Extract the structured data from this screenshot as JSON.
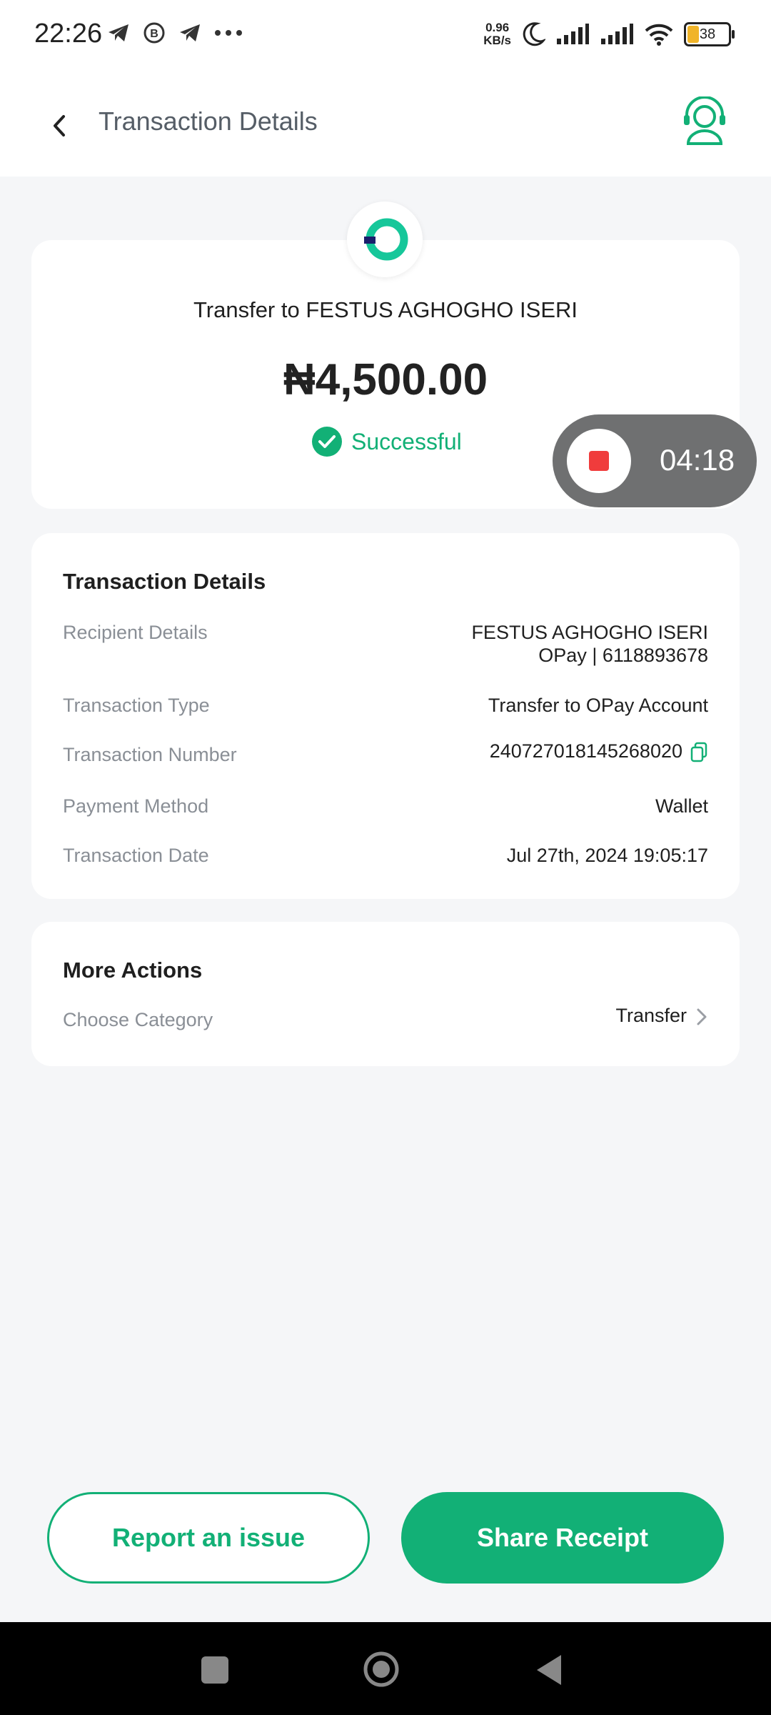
{
  "status_bar": {
    "time": "22:26",
    "net_speed_top": "0.96",
    "net_speed_bottom": "KB/s",
    "battery": "38",
    "icons": [
      "telegram-icon",
      "whatsapp-business-icon",
      "telegram-icon",
      "more-dots-icon",
      "moon-icon",
      "signal-icon",
      "signal-icon",
      "wifi-icon",
      "battery-icon"
    ]
  },
  "header": {
    "title": "Transaction Details",
    "back_icon": "chevron-left-icon",
    "support_icon": "customer-support-icon"
  },
  "summary": {
    "transfer_to": "Transfer to FESTUS AGHOGHO ISERI",
    "amount": "₦4,500.00",
    "status": "Successful"
  },
  "recorder": {
    "time": "04:18"
  },
  "details": {
    "title": "Transaction Details",
    "rows": [
      {
        "label": "Recipient Details",
        "value": "FESTUS AGHOGHO ISERI",
        "value2": "OPay | 6118893678"
      },
      {
        "label": "Transaction Type",
        "value": "Transfer to OPay Account"
      },
      {
        "label": "Transaction Number",
        "value": "240727018145268020"
      },
      {
        "label": "Payment Method",
        "value": "Wallet"
      },
      {
        "label": "Transaction Date",
        "value": "Jul 27th, 2024 19:05:17"
      }
    ]
  },
  "more_actions": {
    "title": "More Actions",
    "category_label": "Choose Category",
    "category_value": "Transfer"
  },
  "buttons": {
    "report": "Report an issue",
    "share": "Share Receipt"
  },
  "colors": {
    "accent": "#12b076",
    "background": "#f5f6f8",
    "recorder": "#6f7071",
    "record_red": "#f03c3c"
  }
}
